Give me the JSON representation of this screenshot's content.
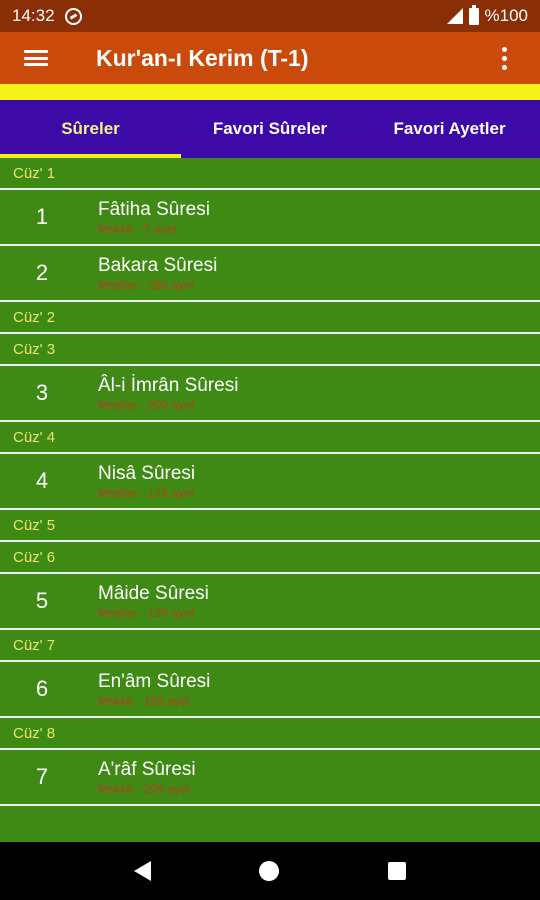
{
  "status_bar": {
    "time": "14:32",
    "battery": "%100"
  },
  "app_bar": {
    "title": "Kur'an-ı Kerim (T-1)"
  },
  "tabs": [
    {
      "label": "Sûreler",
      "active": true
    },
    {
      "label": "Favori Sûreler",
      "active": false
    },
    {
      "label": "Favori Ayetler",
      "active": false
    }
  ],
  "juz": {
    "j1": "Cüz' 1",
    "j2": "Cüz' 2",
    "j3": "Cüz' 3",
    "j4": "Cüz' 4",
    "j5": "Cüz' 5",
    "j6": "Cüz' 6",
    "j7": "Cüz' 7",
    "j8": "Cüz' 8"
  },
  "suras": [
    {
      "num": "1",
      "name": "Fâtiha Sûresi",
      "meta": "Mekke - 7 ayet"
    },
    {
      "num": "2",
      "name": "Bakara Sûresi",
      "meta": "Medine - 286 ayet"
    },
    {
      "num": "3",
      "name": "Âl-i İmrân Sûresi",
      "meta": "Medine - 200 ayet"
    },
    {
      "num": "4",
      "name": "Nisâ Sûresi",
      "meta": "Medine - 176 ayet"
    },
    {
      "num": "5",
      "name": "Mâide Sûresi",
      "meta": "Medine - 120 ayet"
    },
    {
      "num": "6",
      "name": "En'âm Sûresi",
      "meta": "Mekke - 165 ayet"
    },
    {
      "num": "7",
      "name": "A'râf Sûresi",
      "meta": "Mekke - 206 ayet"
    }
  ],
  "colors": {
    "status_bar": "#8a2e06",
    "app_bar": "#c94a0a",
    "accent": "#f5f21a",
    "tab_bar": "#3d0aa8",
    "list_bg": "#3f8a14",
    "juz_text": "#e8e870",
    "meta_text": "#b0411e"
  },
  "icons": {
    "menu": "hamburger-menu-icon",
    "overflow": "more-vertical-icon",
    "status": [
      "sync-icon",
      "signal-icon",
      "battery-icon"
    ],
    "nav": [
      "back-icon",
      "home-icon",
      "recents-icon"
    ]
  }
}
